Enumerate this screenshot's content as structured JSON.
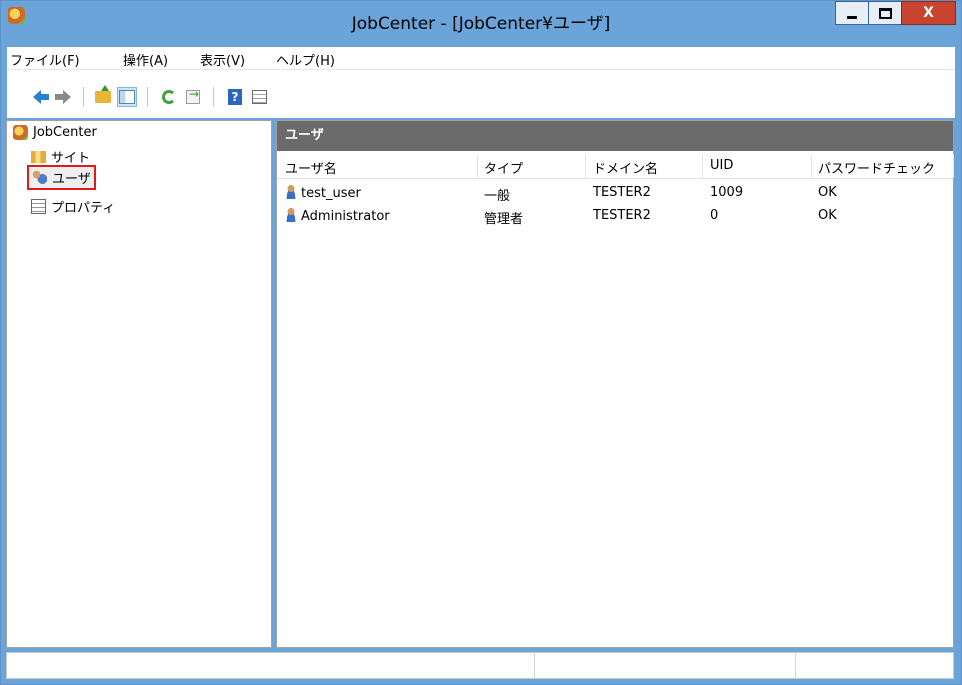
{
  "window": {
    "title": "JobCenter - [JobCenter¥ユーザ]",
    "close_label": "X"
  },
  "menu": [
    "ファイル(F)",
    "操作(A)",
    "表示(V)",
    "ヘルプ(H)"
  ],
  "toolbar": {
    "icons": [
      "back-arrow-icon",
      "forward-arrow-icon",
      "up-folder-icon",
      "show-hide-tree-icon",
      "refresh-icon",
      "export-list-icon",
      "help-icon",
      "properties-icon"
    ]
  },
  "tree": {
    "root": "JobCenter",
    "items": [
      {
        "label": "サイト",
        "icon": "site-icon"
      },
      {
        "label": "ユーザ",
        "icon": "users-icon",
        "selected": true
      },
      {
        "label": "プロパティ",
        "icon": "properties-icon"
      }
    ]
  },
  "list": {
    "header": "ユーザ",
    "columns": [
      "ユーザ名",
      "タイプ",
      "ドメイン名",
      "UID",
      "パスワードチェック"
    ],
    "rows": [
      {
        "name": "test_user",
        "type": "一般",
        "domain": "TESTER2",
        "uid": "1009",
        "password_check": "OK"
      },
      {
        "name": "Administrator",
        "type": "管理者",
        "domain": "TESTER2",
        "uid": "0",
        "password_check": "OK"
      }
    ]
  },
  "colors": {
    "titlebar": "#6ba4d9",
    "close_button": "#c8442f",
    "pane_header": "#6b6b6b",
    "selection_highlight": "#e01b1b"
  }
}
